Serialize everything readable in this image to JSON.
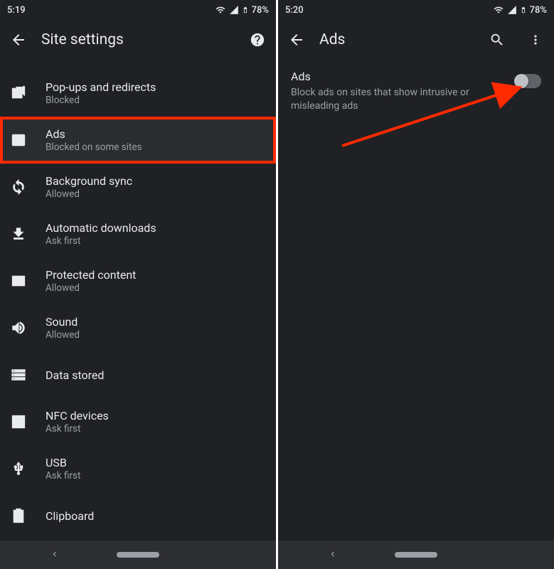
{
  "left": {
    "status": {
      "time": "5:19",
      "battery": "78%"
    },
    "title": "Site settings",
    "items": [
      {
        "icon": "popup-icon",
        "title": "Pop-ups and redirects",
        "sub": "Blocked"
      },
      {
        "icon": "ads-icon",
        "title": "Ads",
        "sub": "Blocked on some sites",
        "highlight": true
      },
      {
        "icon": "sync-icon",
        "title": "Background sync",
        "sub": "Allowed"
      },
      {
        "icon": "download-icon",
        "title": "Automatic downloads",
        "sub": "Ask first"
      },
      {
        "icon": "protected-icon",
        "title": "Protected content",
        "sub": "Allowed"
      },
      {
        "icon": "sound-icon",
        "title": "Sound",
        "sub": "Allowed"
      },
      {
        "icon": "storage-icon",
        "title": "Data stored",
        "sub": ""
      },
      {
        "icon": "nfc-icon",
        "title": "NFC devices",
        "sub": "Ask first"
      },
      {
        "icon": "usb-icon",
        "title": "USB",
        "sub": "Ask first"
      },
      {
        "icon": "clipboard-icon",
        "title": "Clipboard",
        "sub": ""
      }
    ]
  },
  "right": {
    "status": {
      "time": "5:20",
      "battery": "78%"
    },
    "title": "Ads",
    "setting": {
      "title": "Ads",
      "desc": "Block ads on sites that show intrusive or misleading ads",
      "enabled": false
    }
  }
}
